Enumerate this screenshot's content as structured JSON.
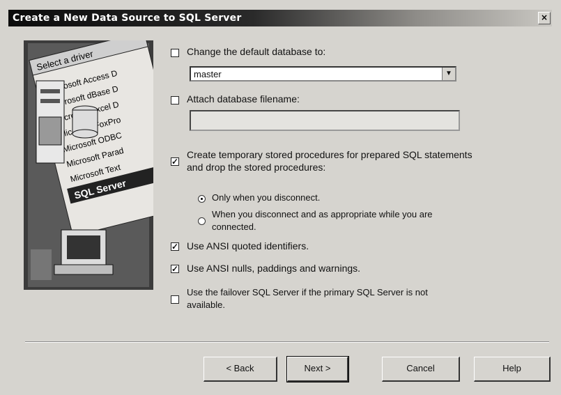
{
  "window": {
    "title": "Create a New Data Source to SQL Server",
    "close_glyph": "×"
  },
  "illustration": {
    "header": "Select a driver",
    "drivers": [
      "Microsoft Access D",
      "Microsoft dBase D",
      "Microsoft Excel D",
      "Microsoft FoxPro",
      "Microsoft ODBC",
      "Microsoft Parad",
      "Microsoft Text",
      "SQL Server"
    ]
  },
  "options": {
    "change_default_db": {
      "label": "Change the default database to:",
      "checked": false
    },
    "database_select": {
      "value": "master"
    },
    "attach_db": {
      "label": "Attach database filename:",
      "checked": false
    },
    "attach_db_value": "",
    "create_temp_procs": {
      "label_line1": "Create temporary stored procedures for prepared SQL statements",
      "label_line2": "and drop the stored procedures:",
      "checked": true
    },
    "radio_disconnect": {
      "label": "Only when you disconnect.",
      "selected": true
    },
    "radio_appropriate": {
      "label_line1": "When you disconnect and as appropriate while you are",
      "label_line2": "connected.",
      "selected": false
    },
    "ansi_quoted": {
      "label": "Use ANSI quoted identifiers.",
      "checked": true
    },
    "ansi_nulls": {
      "label": "Use ANSI nulls, paddings and warnings.",
      "checked": true
    },
    "failover": {
      "label_line1": "Use the failover SQL Server if the primary SQL Server is not",
      "label_line2": "available.",
      "checked": false
    }
  },
  "buttons": {
    "back": "< Back",
    "next": "Next >",
    "cancel": "Cancel",
    "help": "Help"
  },
  "marks": {
    "check": "✓"
  }
}
